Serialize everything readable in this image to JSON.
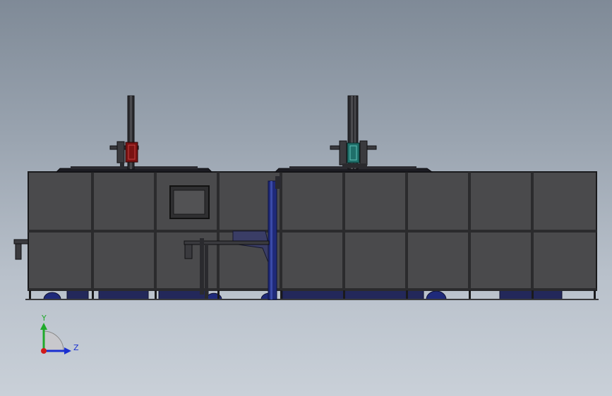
{
  "viewport": {
    "background_top": "#7f8a97",
    "background_bottom": "#c9d0d8"
  },
  "colors": {
    "panel_fill": "#4a4a4c",
    "frame": "#1a1a1c",
    "blue_component": "#1f2a7a",
    "navy_base": "#23285a",
    "red_component": "#7a1212",
    "teal_component": "#1f6f6a",
    "axis_x": "#d11a1a",
    "axis_y": "#1faa2a",
    "axis_z": "#1a2fd1"
  },
  "axis_triad": {
    "y_label": "Y",
    "z_label": "Z"
  }
}
